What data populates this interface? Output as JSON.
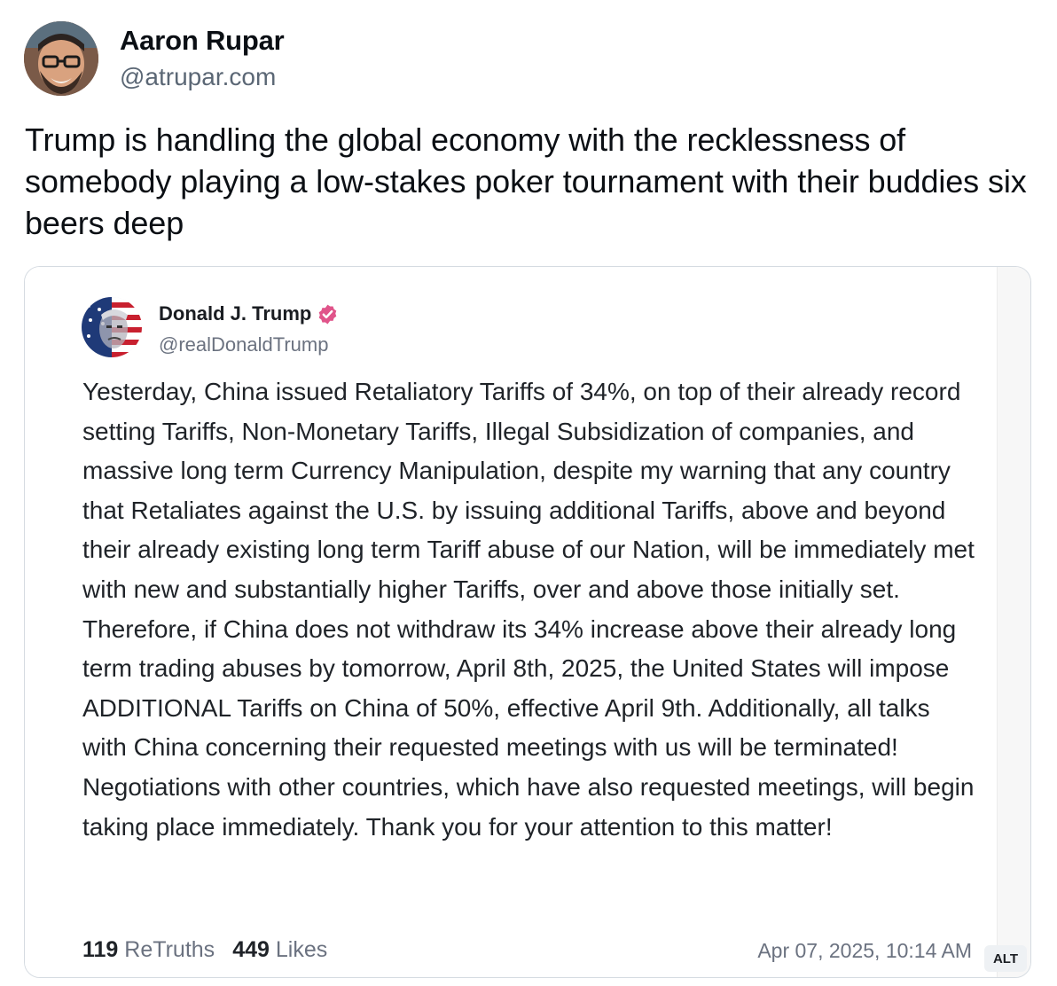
{
  "author": {
    "name": "Aaron Rupar",
    "handle": "@atrupar.com",
    "avatar_icon": "user-avatar"
  },
  "post": {
    "text": "Trump is handling the global economy with the recklessness of somebody playing a low-stakes poker tournament with their buddies six beers deep"
  },
  "embed": {
    "author_name": "Donald J. Trump",
    "author_handle": "@realDonaldTrump",
    "verified_icon": "verified-badge-icon",
    "verified_color": "#e0548a",
    "text": "Yesterday, China issued Retaliatory Tariffs of 34%, on top of their already record setting Tariffs, Non-Monetary Tariffs, Illegal Subsidization of companies, and massive long term Currency Manipulation, despite my warning that any country that Retaliates against the U.S. by issuing additional Tariffs, above and beyond their already existing long term Tariff abuse of our Nation, will be immediately met with new and substantially higher Tariffs, over and above those initially set. Therefore, if China does not withdraw its 34% increase above their already long term trading abuses by tomorrow, April 8th, 2025, the United States will impose ADDITIONAL Tariffs on China of 50%, effective April 9th. Additionally, all talks with China concerning their requested meetings with us will be terminated! Negotiations with other countries, which have also requested meetings, will begin taking place immediately. Thank you for your attention to this matter!",
    "retruths_count": "119",
    "retruths_label": "ReTruths",
    "likes_count": "449",
    "likes_label": "Likes",
    "timestamp": "Apr 07, 2025, 10:14 AM"
  },
  "alt_badge": "ALT"
}
